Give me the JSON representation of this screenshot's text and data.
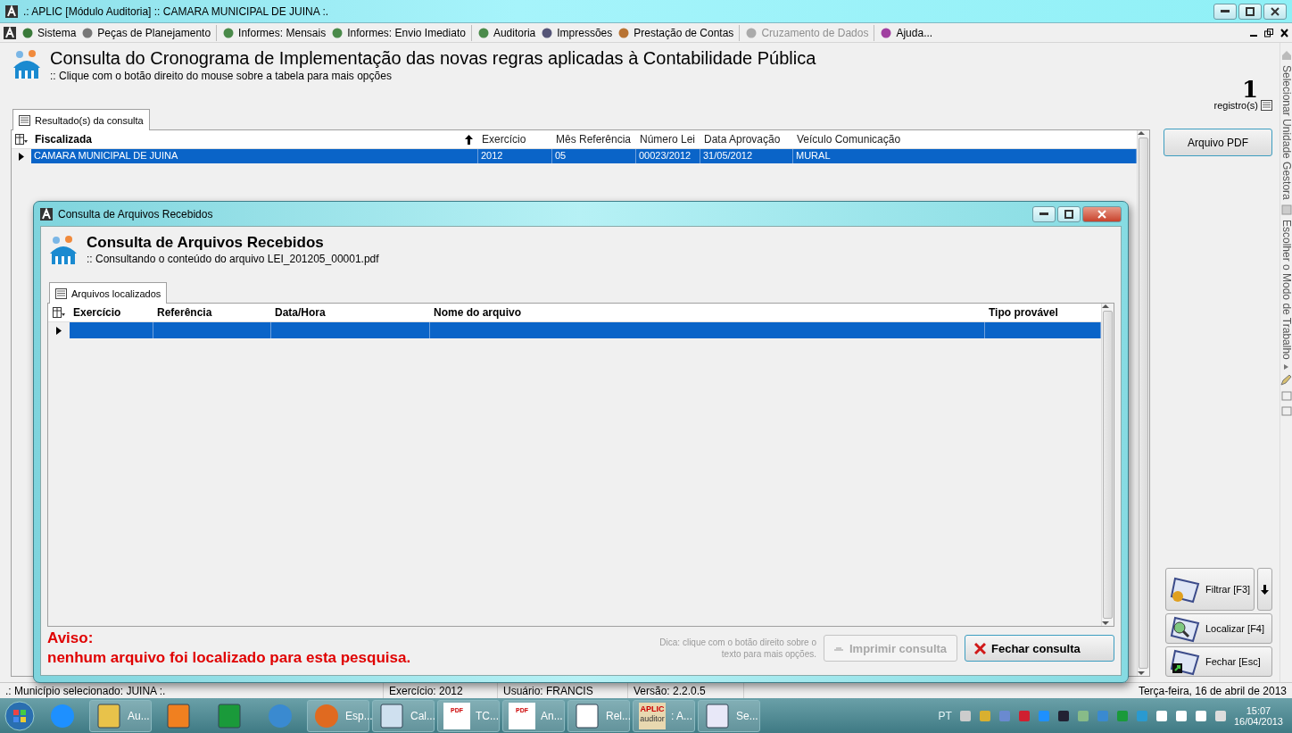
{
  "window": {
    "title": ".: APLIC [Módulo Auditoria] :: CAMARA MUNICIPAL DE JUINA :."
  },
  "menu": [
    {
      "label": "Sistema",
      "disabled": false
    },
    {
      "label": "Peças de Planejamento",
      "disabled": false
    },
    {
      "label": "Informes: Mensais",
      "disabled": false
    },
    {
      "label": "Informes: Envio Imediato",
      "disabled": false
    },
    {
      "label": "Auditoria",
      "disabled": false
    },
    {
      "label": "Impressões",
      "disabled": false
    },
    {
      "label": "Prestação de Contas",
      "disabled": false
    },
    {
      "label": "Cruzamento de Dados",
      "disabled": true
    },
    {
      "label": "Ajuda...",
      "disabled": false
    }
  ],
  "header": {
    "title": "Consulta do Cronograma de Implementação das novas regras aplicadas à Contabilidade Pública",
    "subtitle": ":: Clique com o botão direito do mouse sobre a tabela para mais opções",
    "count": "1",
    "count_label": "registro(s)"
  },
  "tabs": [
    {
      "label": "Resultado(s) da consulta",
      "selected": true
    }
  ],
  "table": {
    "columns": [
      "Fiscalizada",
      "Exercício",
      "Mês Referência",
      "Número Lei",
      "Data Aprovação",
      "Veículo Comunicação"
    ],
    "rows": [
      {
        "selected": true,
        "cells": [
          "CAMARA MUNICIPAL DE JUINA",
          "2012",
          "05",
          "00023/2012",
          "31/05/2012",
          "MURAL"
        ]
      }
    ]
  },
  "side_buttons": [
    {
      "kind": "plain",
      "label": "Arquivo PDF"
    },
    {
      "kind": "filter",
      "label": "Filtrar [F3]"
    },
    {
      "kind": "find",
      "label": "Localizar [F4]"
    },
    {
      "kind": "close",
      "label": "Fechar [Esc]"
    }
  ],
  "vertical_bar": [
    "Selecionar Unidade Gestora",
    "Escolher o Modo de Trabalho"
  ],
  "dialog": {
    "title": "Consulta de Arquivos Recebidos",
    "heading": "Consulta de Arquivos Recebidos",
    "subtitle": ":: Consultando o conteúdo do arquivo LEI_201205_00001.pdf",
    "tabs": [
      {
        "label": "Arquivos localizados",
        "selected": true
      }
    ],
    "table": {
      "columns": [
        "Exercício",
        "Referência",
        "Data/Hora",
        "Nome do arquivo",
        "Tipo provável"
      ],
      "rows": [
        {
          "selected": true
        }
      ]
    },
    "warning_title": "Aviso:",
    "warning_text": "nenhum arquivo foi localizado para esta pesquisa.",
    "hint": "Dica: clique com o botão direito sobre o texto para mais opções.",
    "buttons": [
      {
        "label": "Imprimir consulta",
        "disabled": true,
        "kind": "print"
      },
      {
        "label": "Fechar consulta",
        "disabled": false,
        "kind": "close"
      }
    ]
  },
  "status_bar": [
    ".: Município selecionado: JUINA :.",
    "Exercício: 2012",
    "Usuário:  FRANCIS",
    "Versão: 2.2.0.5",
    "Terça-feira, 16 de abril de 2013"
  ],
  "taskbar": {
    "items": [
      {
        "kind": "ie"
      },
      {
        "kind": "folder",
        "label": "Au..."
      },
      {
        "kind": "media"
      },
      {
        "kind": "chart"
      },
      {
        "kind": "wifi"
      },
      {
        "kind": "firefox",
        "label": "Esp..."
      },
      {
        "kind": "calc",
        "label": "Cal..."
      },
      {
        "kind": "pdf",
        "label": "TC...",
        "icon_label": "PDF"
      },
      {
        "kind": "pdf",
        "label": "An...",
        "icon_label": "PDF"
      },
      {
        "kind": "doc",
        "label": "Rel..."
      },
      {
        "kind": "aplic",
        "label": ": A...",
        "icon_label": "APLIC",
        "icon_sublabel": "auditor"
      },
      {
        "kind": "paint",
        "label": "Se..."
      }
    ],
    "language": "PT",
    "time": "15:07",
    "date": "16/04/2013"
  }
}
